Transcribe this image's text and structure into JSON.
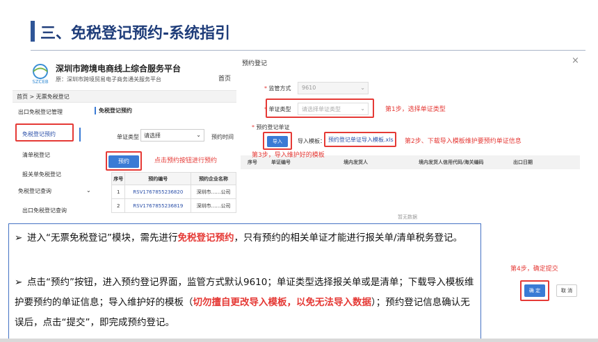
{
  "slide": {
    "title": "三、免税登记预约-系统指引"
  },
  "portal": {
    "name": "深圳市跨境电商线上综合服务平台",
    "subtitle": "原：深圳市跨境贸易电子商务通关服务平台",
    "logo_text": "SZCEB",
    "nav_home": "首页",
    "breadcrumb": "首页 > 无票免税登记",
    "sidebar": {
      "items": [
        {
          "label": "出口免税登记管理"
        },
        {
          "label": "免税登记预约"
        },
        {
          "label": "清单税登记"
        },
        {
          "label": "报关单免税登记"
        },
        {
          "label": "免税登记查询"
        },
        {
          "label": "出口免税登记查询"
        }
      ]
    },
    "page_heading": "免税登记预约",
    "filter": {
      "type_label": "单证类型",
      "type_value": "请选择",
      "date_label": "预约时间"
    },
    "reserve_button": "预约",
    "tip_reserve": "点击预约按钮进行预约",
    "table": {
      "headers": [
        "序号",
        "预约编号",
        "预约企业名称"
      ],
      "rows": [
        {
          "no": "1",
          "code": "RSV1767855236820",
          "company": "深圳市……公司"
        },
        {
          "no": "2",
          "code": "RSV1767855236819",
          "company": "深圳市……公司"
        }
      ]
    }
  },
  "dialog": {
    "title": "预约登记",
    "close": "×",
    "supervise_label": "监管方式",
    "supervise_value": "9610",
    "doctype_label": "单证类型",
    "doctype_placeholder": "请选择单证类型",
    "step1": "第1步，选择单证类型",
    "register_label": "预约登记单证",
    "import_button": "导入",
    "template_label": "导入模板：",
    "template_link": "预约登记单证导入模板.xls",
    "step2": "第2步、下载导入模板维护要预约单证信息",
    "step3": "第3步，导入维护好的模板",
    "table_headers": [
      "序号",
      "单证编号",
      "境内发货人",
      "境内发货人信用代码/海关编码",
      "出口日期"
    ],
    "no_data": "暂无数据",
    "step4": "第4步，确定提交",
    "confirm_button": "确 定",
    "cancel_button": "取 消"
  },
  "instructions": {
    "b1_pre": "进入“无票免税登记”模块，需先进行",
    "b1_hl": "免税登记预约",
    "b1_post": "，只有预约的相关单证才能进行报关单/清单税务登记。",
    "b2_pre": "点击“预约”按钮，进入预约登记界面，监管方式默认9610；单证类型选择报关单或是清单；下载导入模板维护要预约的单证信息；导入维护好的模板（",
    "b2_hl": "切勿擅自更改导入模板，以免无法导入数据",
    "b2_post": "）；预约登记信息确认无误后，点击“提交”，即完成预约登记。"
  },
  "colors": {
    "accent": "#2f5597",
    "highlight": "#e53935",
    "button": "#3a7bd5"
  }
}
